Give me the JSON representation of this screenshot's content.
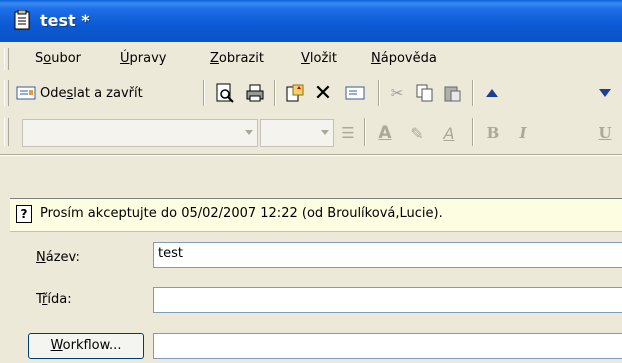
{
  "window": {
    "title": "test *"
  },
  "menu": {
    "items": [
      {
        "pre": "S",
        "acc": "o",
        "post": "ubor"
      },
      {
        "pre": "",
        "acc": "Ú",
        "post": "pravy"
      },
      {
        "pre": "",
        "acc": "Z",
        "post": "obrazit"
      },
      {
        "pre": "",
        "acc": "V",
        "post": "ložit"
      },
      {
        "pre": "",
        "acc": "N",
        "post": "ápověda"
      }
    ]
  },
  "toolbar": {
    "send_label_pre": "Ode",
    "send_label_acc": "s",
    "send_label_post": "lat a zavřít"
  },
  "format": {
    "bold": "B",
    "italic": "I",
    "underline": "U"
  },
  "infobar": {
    "text": "Prosím akceptujte do 05/02/2007 12:22 (od Broulíková,Lucie)."
  },
  "form": {
    "name_label_acc": "N",
    "name_label_post": "ázev:",
    "name_value": "test",
    "class_label_pre": "T",
    "class_label_acc": "ř",
    "class_label_post": "ída:",
    "class_value": "",
    "workflow_acc": "W",
    "workflow_post": "orkflow...",
    "workflow_value": ""
  }
}
